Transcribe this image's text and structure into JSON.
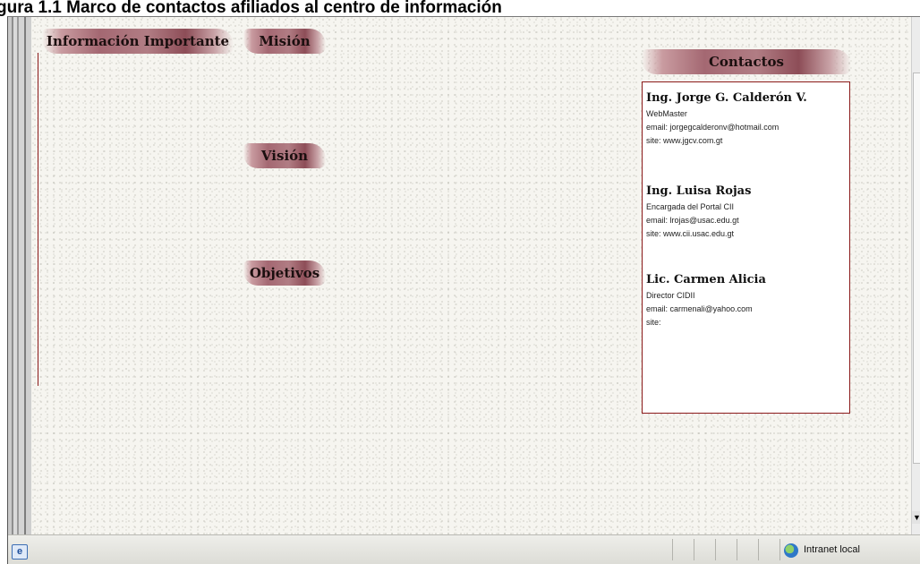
{
  "caption": "gura     1.1  Marco de contactos afiliados al centro de información",
  "nav": {
    "info": "Información Importante",
    "mision": "Misión",
    "vision": "Visión",
    "objetivos": "Objetivos"
  },
  "contacts_header": "Contactos",
  "contacts": [
    {
      "name": "Ing. Jorge G. Calderón V.",
      "role": "WebMaster",
      "email": "email: jorgegcalderonv@hotmail.com",
      "site": "site: www.jgcv.com.gt"
    },
    {
      "name": "Ing. Luisa Rojas",
      "role": "Encargada del Portal CII",
      "email": "email: lrojas@usac.edu.gt",
      "site": "site: www.cii.usac.edu.gt"
    },
    {
      "name": "Lic. Carmen Alicia",
      "role": "Director CIDII",
      "email": "email: carmenali@yahoo.com",
      "site": "site:"
    }
  ],
  "status": {
    "zone_label": "Intranet local",
    "page_icon": "ie-page-icon",
    "zone_icon": "intranet-globe-icon"
  },
  "colors": {
    "accent": "#8b1a1a",
    "brush": "#a46872"
  }
}
